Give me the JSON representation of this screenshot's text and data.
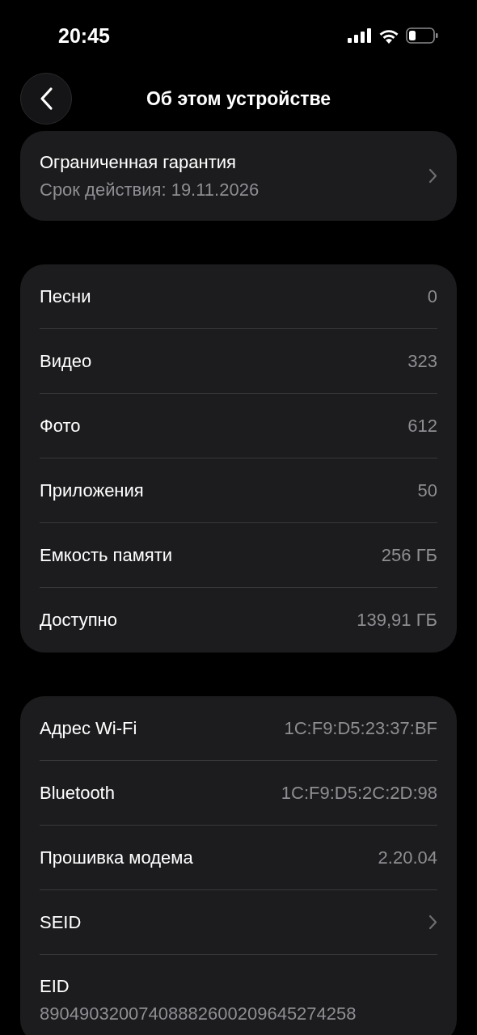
{
  "status_bar": {
    "time": "20:45"
  },
  "nav": {
    "title": "Об этом устройстве"
  },
  "warranty": {
    "title": "Ограниченная гарантия",
    "subtitle": "Срок действия: 19.11.2026"
  },
  "groups": [
    {
      "rows": [
        {
          "kind": "value",
          "label": "Песни",
          "value": "0"
        },
        {
          "kind": "value",
          "label": "Видео",
          "value": "323"
        },
        {
          "kind": "value",
          "label": "Фото",
          "value": "612"
        },
        {
          "kind": "value",
          "label": "Приложения",
          "value": "50"
        },
        {
          "kind": "value",
          "label": "Емкость памяти",
          "value": "256 ГБ"
        },
        {
          "kind": "value",
          "label": "Доступно",
          "value": "139,91 ГБ"
        }
      ]
    },
    {
      "rows": [
        {
          "kind": "value",
          "label": "Адрес Wi-Fi",
          "value": "1C:F9:D5:23:37:BF"
        },
        {
          "kind": "value",
          "label": "Bluetooth",
          "value": "1C:F9:D5:2C:2D:98"
        },
        {
          "kind": "value",
          "label": "Прошивка модема",
          "value": "2.20.04"
        },
        {
          "kind": "chevron",
          "label": "SEID"
        },
        {
          "kind": "stacked",
          "label": "EID",
          "value": "89049032007408882600209645274258"
        }
      ]
    }
  ]
}
